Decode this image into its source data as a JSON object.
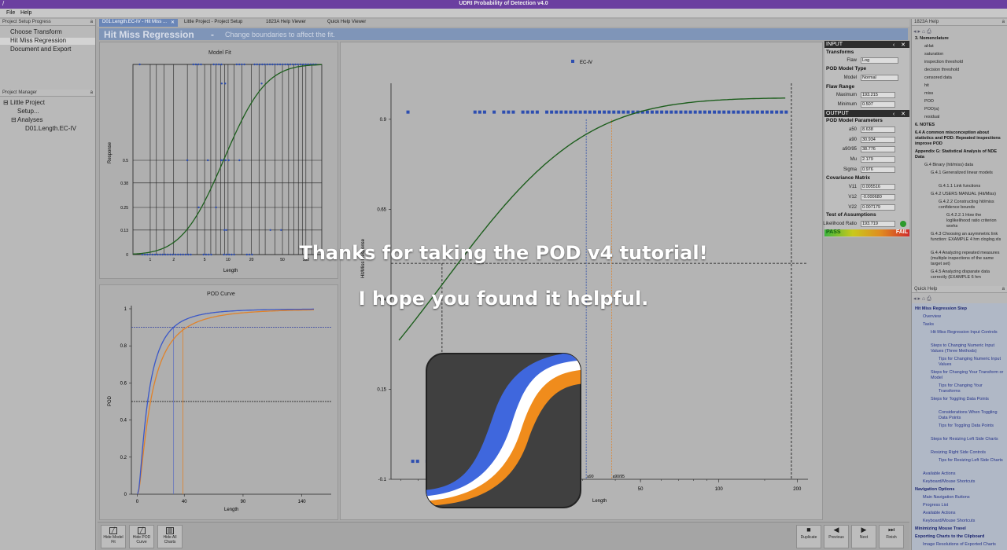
{
  "window": {
    "title": "UDRI Probability of Detection v4.0",
    "controls": [
      "—",
      "▢",
      "✕"
    ]
  },
  "menu": [
    "File",
    "Help"
  ],
  "left": {
    "progress_header": "Project Setup Progress",
    "progress_pin": "a",
    "progress_items": [
      "Choose Transform",
      "Hit Miss Regression",
      "Document and Export"
    ],
    "manager_header": "Project Manager",
    "manager_pin": "a",
    "tree": [
      "Little Project",
      "Setup...",
      "Analyses",
      "D01.Length.EC-IV"
    ]
  },
  "tabs": [
    "D01.Length.EC-IV - Hit Miss ...",
    "Little Project - Project Setup",
    "1823A Help Viewer",
    "Quick Help Viewer"
  ],
  "tab_close": "✕",
  "header": {
    "title": "Hit Miss Regression",
    "separator": "-",
    "subtitle": "Change boundaries to affect the fit."
  },
  "model_fit": {
    "title": "Model Fit",
    "xlabel": "Length",
    "ylabel": "Response",
    "xticks": [
      "1",
      "2",
      "5",
      "10",
      "20",
      "50",
      "100"
    ],
    "yticks": [
      "0",
      "0.13",
      "0.25",
      "0.38",
      "0.5"
    ]
  },
  "pod_curve": {
    "title": "POD Curve",
    "xlabel": "Length",
    "ylabel": "POD",
    "xticks": [
      "0",
      "40",
      "90",
      "140"
    ],
    "yticks": [
      "0",
      "0.2",
      "0.4",
      "0.6",
      "0.8",
      "1"
    ]
  },
  "main_chart": {
    "legend": "EC-IV",
    "ylabel": "Hit/Miss Response",
    "xlabel": "Length",
    "yticks": [
      "-0.1",
      "0.15",
      "0.4",
      "0.65",
      "0.9"
    ],
    "xticks": [
      "10",
      "20",
      "50",
      "100",
      "200"
    ],
    "xlabels": [
      "a50",
      "a90",
      "a90/95"
    ]
  },
  "chart_data": {
    "type": "scatter",
    "title": "",
    "xlabel": "Length",
    "ylabel": "Hit/Miss Response",
    "x_scale": "log",
    "series": [
      {
        "name": "EC-IV",
        "description_values": "hit/miss points at 1 (hit) and 0 (miss)"
      }
    ],
    "pod_fit": {
      "a50": 8.638,
      "a90": 30.934,
      "a90_95": 38.776
    }
  },
  "io": {
    "input_label": "INPUT",
    "transforms": "Transforms",
    "flaw_label": "Flaw",
    "flaw_value": "Log",
    "pod_model_type": "POD Model Type",
    "model_label": "Model",
    "model_value": "Normal",
    "flaw_range": "Flaw Range",
    "max_label": "Maximum",
    "max_value": "193.215",
    "min_label": "Minimum",
    "min_value": "0.507",
    "output_label": "OUTPUT",
    "pod_params": "POD Model Parameters",
    "a50_label": "a50",
    "a50_value": "8.638",
    "a90_label": "a90",
    "a90_value": "30.934",
    "a9095_label": "a90/95",
    "a9095_value": "38.776",
    "mu_label": "Mu",
    "mu_value": "2.179",
    "sigma_label": "Sigma",
    "sigma_value": "0.976",
    "cov_matrix": "Covariance Matrix",
    "v11_label": "V11",
    "v11_value": "0.005516",
    "v12_label": "V12",
    "v12_value": "-0.000680",
    "v22_label": "V22",
    "v22_value": "0.007179",
    "test_assumptions": "Test of Assumptions",
    "lr_label": "Likelihood Ratio",
    "lr_value": "193.719",
    "pass": "PASS",
    "fail": "FAIL"
  },
  "help_1823a": {
    "header": "1823A Help",
    "pin": "a",
    "items": [
      "3. Nomenclature",
      "aHat",
      "saturation",
      "inspection threshold",
      "decision threshold",
      "censored data",
      "hit",
      "miss",
      "POD",
      "POD(a)",
      "residual",
      "6. NOTES",
      "6.4 A common misconception about statistics and POD: Repeated inspections improve POD",
      "Appendix G: Statistical Analysis of NDE Data",
      "G.4 Binary (hit/miss) data",
      "G.4.1 Generalized linear models",
      "G.4.1.1 Link functions",
      "G.4.2 USERS MANUAL (Hit/Miss)",
      "G.4.2.2 Constructing hit/miss confidence bounds",
      "G.4.2.2.1 How the loglikelihood ratio criterion works",
      "G.4.3 Choosing an asymmetric link function: EXAMPLE 4 hm cloglog.xls",
      "G.4.4 Analyzing repeated measures (multiple inspections of the same target set)",
      "G.4.5 Analyzing disparate data correctly (EXAMPLE 6 hm DISPARATE.xls)"
    ]
  },
  "quick_help": {
    "header": "Quick Help",
    "pin": "a",
    "items": [
      "Hit Miss Regression Step",
      "Overview",
      "Tasks",
      "Hit Miss Regression Input Controls",
      "Steps to Changing Numeric Input Values (Three Methods)",
      "Tips for Changing Numeric Input Values",
      "Steps for Changing Your Transform or Model",
      "Tips for Changing Your Transforms",
      "Steps for Toggling Data Points",
      "Considerations When Toggling Data Points",
      "Tips for Toggling Data Points",
      "Steps for Resizing Left Side Charts",
      "Resizing Right Side Controls",
      "Tips for Resizing Left Side Charts",
      "Available Actions",
      "Keyboard/Mouse Shortcuts",
      "Navigation Options",
      "Main Navigation Buttons",
      "Progress List",
      "Available Actions",
      "Keyboard/Mouse Shortcuts",
      "Minimizing Mouse Travel",
      "Exporting Charts to the Clipboard",
      "Image Resolutions of Exported Charts"
    ]
  },
  "toolbar": {
    "left": [
      "Hide Model Fit",
      "Hide POD Curve",
      "Hide All Charts"
    ],
    "right": [
      "Duplicate",
      "Previous",
      "Next",
      "Finish"
    ]
  },
  "overlay": {
    "line1": "Thanks for taking the POD v4 tutorial!",
    "line2": "I hope you found it helpful."
  },
  "colors": {
    "pod_blue": "#3a57c8",
    "pod_orange": "#e0822a",
    "fit_green": "#1d5e1d",
    "point_blue": "#2d4eb0"
  }
}
